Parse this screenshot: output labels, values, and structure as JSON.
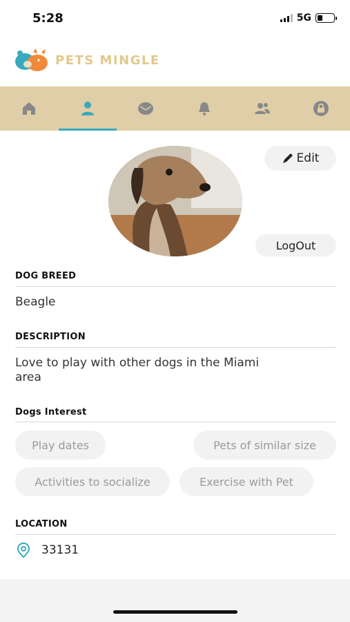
{
  "status_bar": {
    "time": "5:28",
    "network": "5G",
    "battery_level": 0.3
  },
  "header": {
    "app_title": "PETS MINGLE",
    "logo_icon": "pets-logo-icon"
  },
  "nav": {
    "active_index": 1,
    "tabs": [
      {
        "icon": "home-icon"
      },
      {
        "icon": "profile-icon"
      },
      {
        "icon": "mail-icon"
      },
      {
        "icon": "bell-icon"
      },
      {
        "icon": "friends-icon"
      },
      {
        "icon": "lock-icon"
      }
    ],
    "background_color": "#dfcea7",
    "accent_color": "#3aa9bd"
  },
  "profile": {
    "edit_label": "Edit",
    "logout_label": "LogOut"
  },
  "breed": {
    "label": "DOG BREED",
    "value": "Beagle"
  },
  "description": {
    "label": "DESCRIPTION",
    "value": "Love to play with other dogs in the Miami area"
  },
  "interests": {
    "label": "Dogs Interest",
    "items": [
      "Play dates",
      "Pets of similar size",
      "Activities to socialize",
      "Exercise with Pet"
    ]
  },
  "location": {
    "label": "LOCATION",
    "value": "33131",
    "icon": "location-pin-icon"
  }
}
